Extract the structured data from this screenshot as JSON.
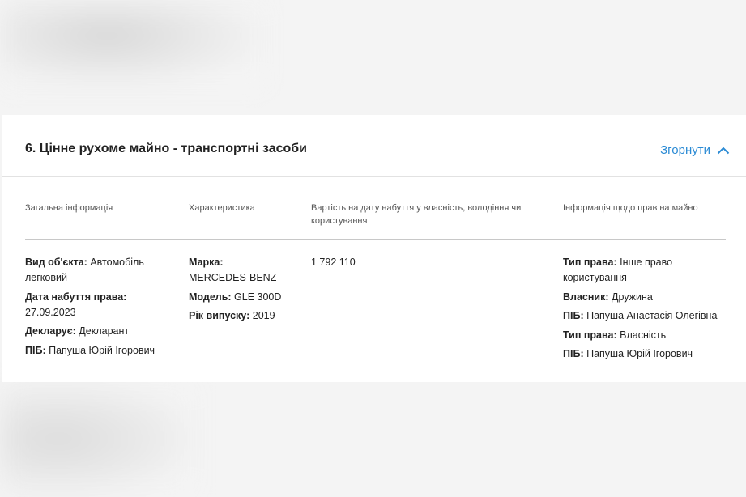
{
  "section": {
    "title": "6. Цінне рухоме майно - транспортні засоби",
    "collapse_label": "Згорнути"
  },
  "columns": {
    "general": "Загальна інформація",
    "characteristics": "Характеристика",
    "value": "Вартість на дату набуття у власність, володіння чи користування",
    "rights": "Інформація щодо прав на майно"
  },
  "general": {
    "object_type_label": "Вид об'єкта:",
    "object_type_value": "Автомобіль легковий",
    "acq_date_label": "Дата набуття права:",
    "acq_date_value": "27.09.2023",
    "declares_label": "Декларує:",
    "declares_value": "Декларант",
    "name_label": "ПІБ:",
    "name_value": "Папуша Юрій Ігорович"
  },
  "characteristics": {
    "brand_label": "Марка:",
    "brand_value": "MERCEDES-BENZ",
    "model_label": "Модель:",
    "model_value": "GLE 300D",
    "year_label": "Рік випуску:",
    "year_value": "2019"
  },
  "value": {
    "amount": "1 792 110"
  },
  "rights": {
    "type1_label": "Тип права:",
    "type1_value": "Інше право користування",
    "owner_label": "Власник:",
    "owner_value": "Дружина",
    "name1_label": "ПІБ:",
    "name1_value": "Папуша Анастасія Олегівна",
    "type2_label": "Тип права:",
    "type2_value": "Власність",
    "name2_label": "ПІБ:",
    "name2_value": "Папуша Юрій Ігорович"
  }
}
